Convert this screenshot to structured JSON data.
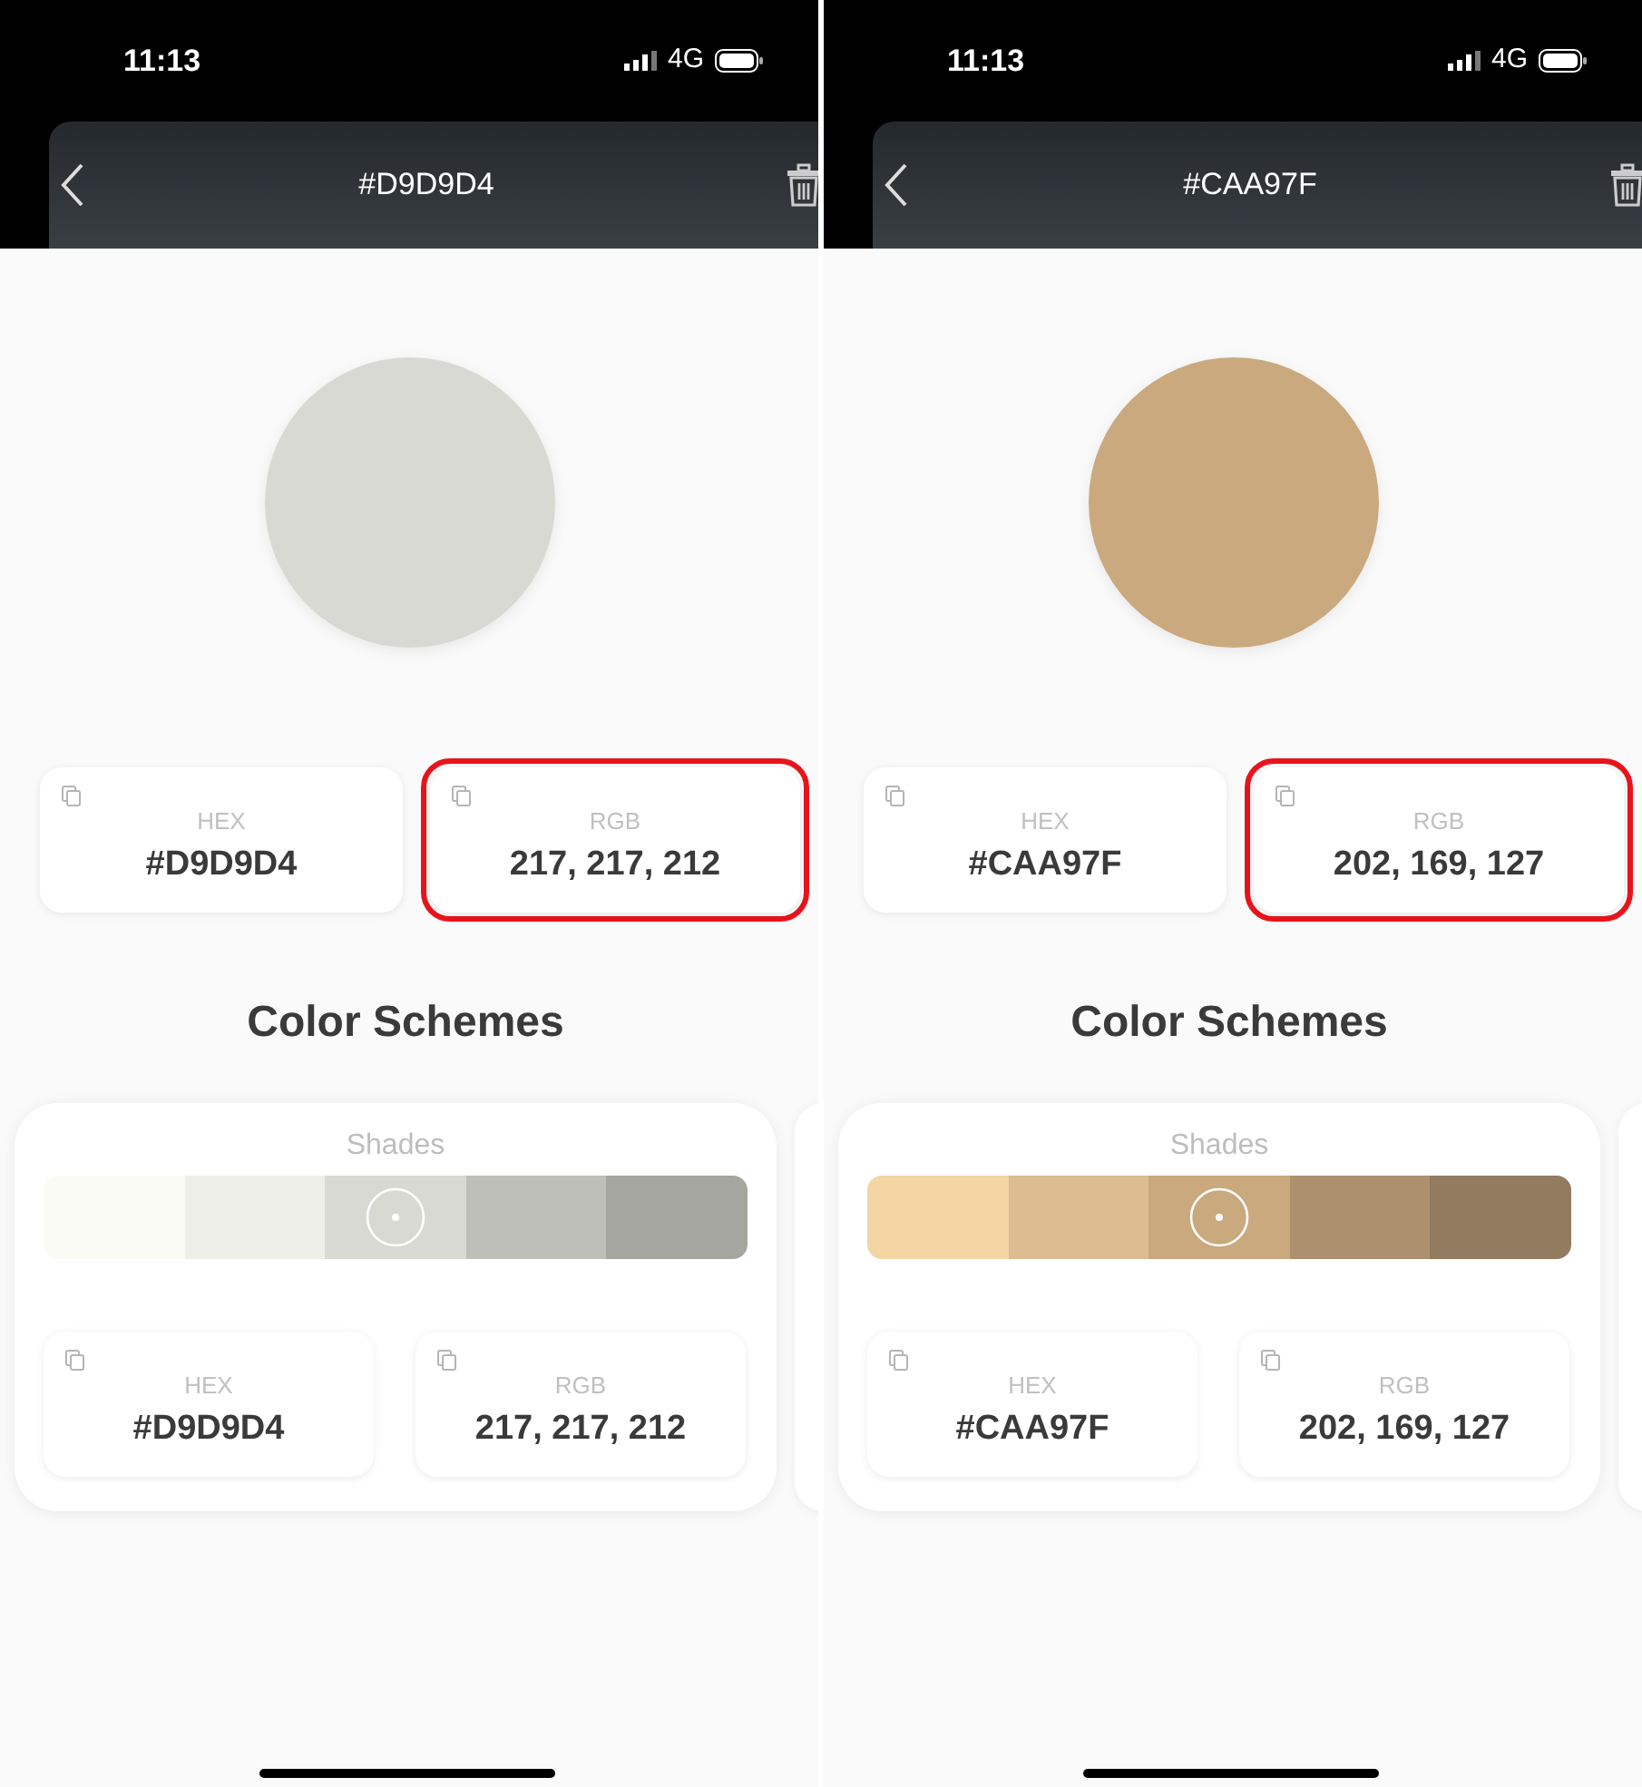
{
  "phones": [
    {
      "status": {
        "time": "11:13",
        "network": "4G"
      },
      "title": "#D9D9D4",
      "color": "#d9d9d4",
      "values": [
        {
          "label": "HEX",
          "value": "#D9D9D4",
          "highlighted": false
        },
        {
          "label": "RGB",
          "value": "217, 217, 212",
          "highlighted": true
        }
      ],
      "section_title": "Color Schemes",
      "scheme": {
        "title": "Shades",
        "shades": [
          {
            "color": "#fbfbf6",
            "selected": false
          },
          {
            "color": "#efefea",
            "selected": false
          },
          {
            "color": "#d9d9d4",
            "selected": true
          },
          {
            "color": "#bfbfba",
            "selected": false
          },
          {
            "color": "#a6a6a1",
            "selected": false
          }
        ],
        "values": [
          {
            "label": "HEX",
            "value": "#D9D9D4"
          },
          {
            "label": "RGB",
            "value": "217, 217, 212"
          }
        ]
      }
    },
    {
      "status": {
        "time": "11:13",
        "network": "4G"
      },
      "title": "#CAA97F",
      "color": "#caa97f",
      "values": [
        {
          "label": "HEX",
          "value": "#CAA97F",
          "highlighted": false
        },
        {
          "label": "RGB",
          "value": "202, 169, 127",
          "highlighted": true
        }
      ],
      "section_title": "Color Schemes",
      "scheme": {
        "title": "Shades",
        "shades": [
          {
            "color": "#f4d5a4",
            "selected": false
          },
          {
            "color": "#dbbd91",
            "selected": false
          },
          {
            "color": "#caa97f",
            "selected": true
          },
          {
            "color": "#ad916f",
            "selected": false
          },
          {
            "color": "#927b5f",
            "selected": false
          }
        ],
        "values": [
          {
            "label": "HEX",
            "value": "#CAA97F"
          },
          {
            "label": "RGB",
            "value": "202, 169, 127"
          }
        ]
      }
    }
  ]
}
